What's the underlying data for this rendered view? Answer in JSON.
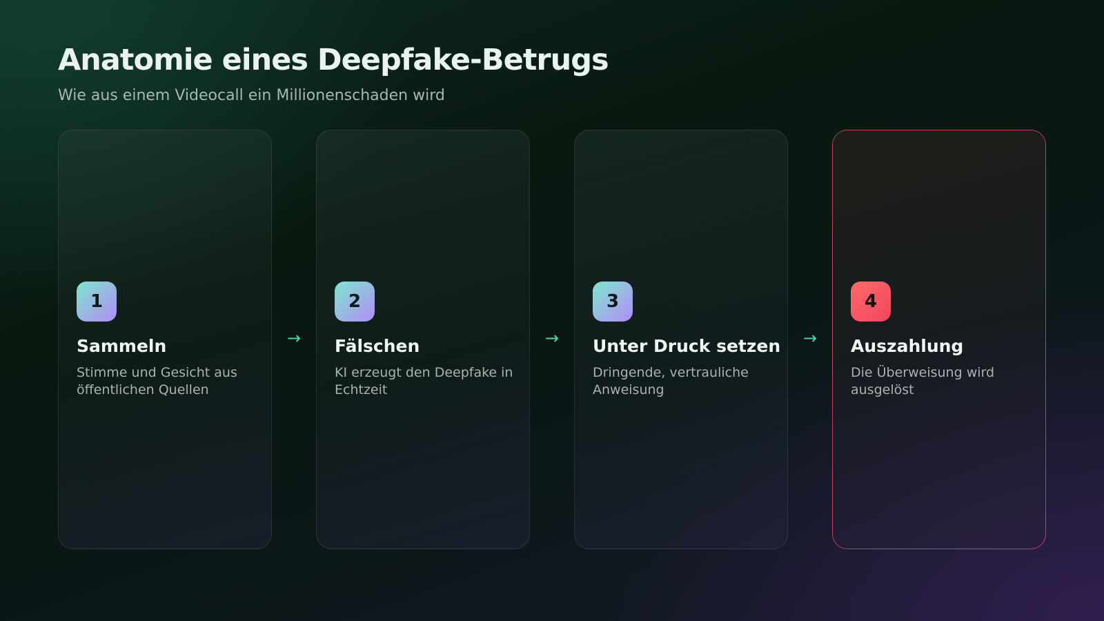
{
  "header": {
    "title": "Anatomie eines Deepfake-Betrugs",
    "subtitle": "Wie aus einem Videocall ein Millionenschaden wird"
  },
  "steps": [
    {
      "number": "1",
      "title": "Sammeln",
      "description": "Stimme und Gesicht aus öffentlichen Quellen"
    },
    {
      "number": "2",
      "title": "Fälschen",
      "description": "KI erzeugt den Deepfake in Echtzeit"
    },
    {
      "number": "3",
      "title": "Unter Druck setzen",
      "description": "Dringende, vertrauliche Anweisung"
    },
    {
      "number": "4",
      "title": "Auszahlung",
      "description": "Die Überweisung wird ausgelöst"
    }
  ],
  "arrow_symbol": "→",
  "colors": {
    "accent": "#4fd6a6",
    "badge_gradient_start": "#7ee6cf",
    "badge_gradient_end": "#b28cf5",
    "alert": "#f0455f",
    "alert_border": "#b8435f"
  }
}
